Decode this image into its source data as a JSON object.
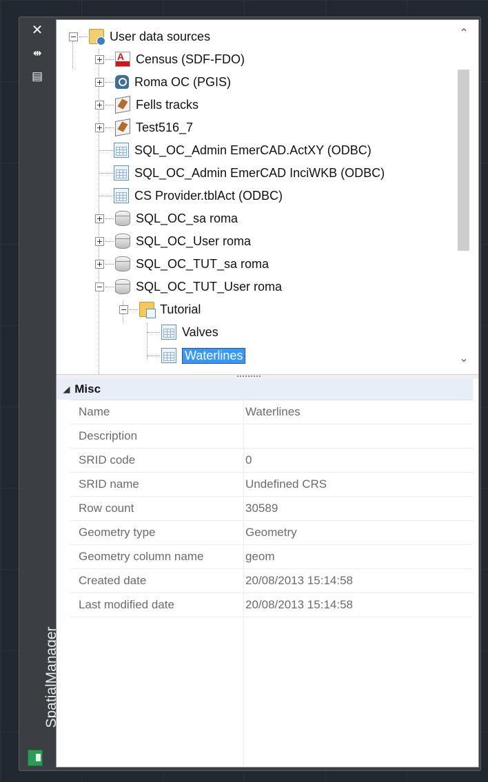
{
  "palette": {
    "title": "SpatialManager",
    "side_buttons": {
      "close_glyph": "✕",
      "autohide_glyph": "⇹",
      "properties_glyph": "▤"
    }
  },
  "tree": {
    "items": [
      {
        "label": "User data sources"
      },
      {
        "label": "Census (SDF-FDO)"
      },
      {
        "label": "Roma OC (PGIS)"
      },
      {
        "label": "Fells tracks"
      },
      {
        "label": "Test516_7"
      },
      {
        "label": "SQL_OC_Admin EmerCAD.ActXY (ODBC)"
      },
      {
        "label": "SQL_OC_Admin EmerCAD InciWKB (ODBC)"
      },
      {
        "label": "CS Provider.tblAct (ODBC)"
      },
      {
        "label": "SQL_OC_sa roma"
      },
      {
        "label": "SQL_OC_User roma"
      },
      {
        "label": "SQL_OC_TUT_sa roma"
      },
      {
        "label": "SQL_OC_TUT_User roma"
      },
      {
        "label": "Tutorial"
      },
      {
        "label": "Valves"
      },
      {
        "label": "Waterlines"
      }
    ],
    "scroll_up": "⌃",
    "scroll_down": "⌄"
  },
  "properties": {
    "category": "Misc",
    "category_glyph": "◢",
    "rows": [
      {
        "name": "Name",
        "value": "Waterlines"
      },
      {
        "name": "Description",
        "value": ""
      },
      {
        "name": "SRID code",
        "value": "0"
      },
      {
        "name": "SRID name",
        "value": "Undefined CRS"
      },
      {
        "name": "Row count",
        "value": "30589"
      },
      {
        "name": "Geometry type",
        "value": "Geometry"
      },
      {
        "name": "Geometry column name",
        "value": "geom"
      },
      {
        "name": "Created date",
        "value": "20/08/2013 15:14:58"
      },
      {
        "name": "Last modified date",
        "value": "20/08/2013 15:14:58"
      }
    ]
  },
  "colors": {
    "selection": "#3399ff",
    "category_band": "#e7eef8",
    "palette_frame": "#3b3f44"
  }
}
